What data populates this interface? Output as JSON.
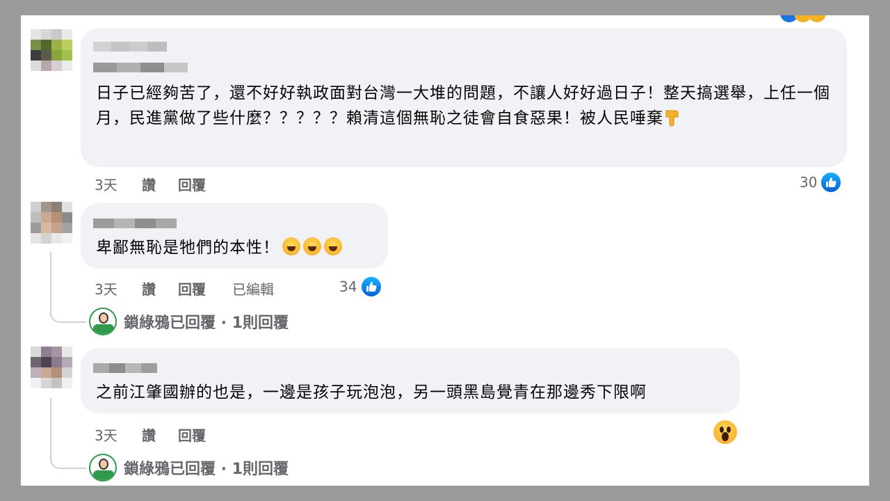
{
  "colors": {
    "background_gray": "#9b9b9b",
    "bubble": "#f0f2f5",
    "text": "#050505",
    "meta": "#65676b",
    "like_blue": "#1b74e4"
  },
  "comments": [
    {
      "text": "日子已經夠苦了，還不好好執政面對台灣一大堆的問題，不讓人好好過日子！整天搞選舉，上任一個月，民進黨做了些什麼？？？？？賴清這個無恥之徒會自食惡果！被人民唾棄",
      "trailing_icon": "thumbs-down-emoji",
      "time": "3天",
      "like_label": "讚",
      "reply_label": "回覆",
      "reaction_count": "30",
      "reaction_icon": "like-icon"
    },
    {
      "text": "卑鄙無恥是牠們的本性！",
      "trailing_icons": [
        "laughing-tears-emoji",
        "laughing-tears-emoji",
        "laughing-tears-emoji"
      ],
      "time": "3天",
      "like_label": "讚",
      "reply_label": "回覆",
      "edited_label": "已編輯",
      "reaction_count": "34",
      "reaction_icon": "like-icon",
      "replies_summary": {
        "text": "鎖綠鴉已回覆 · 1則回覆"
      }
    },
    {
      "text": "之前江肇國辦的也是，一邊是孩子玩泡泡，另一頭黑島覺青在那邊秀下限啊",
      "time": "3天",
      "like_label": "讚",
      "reply_label": "回覆",
      "reaction_icon": "wow-icon",
      "replies_summary": {
        "text": "鎖綠鴉已回覆 · 1則回覆"
      }
    }
  ]
}
